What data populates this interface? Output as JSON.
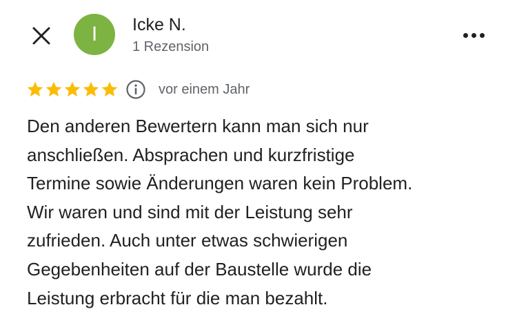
{
  "reviewer": {
    "initial": "I",
    "name": "Icke N.",
    "review_count": "1 Rezension",
    "avatar_color": "#7cb342"
  },
  "review": {
    "rating": 5,
    "max_rating": 5,
    "star_color": "#fbbc04",
    "date": "vor einem Jahr",
    "text_lines": [
      "Den anderen Bewertern kann man sich nur",
      "anschließen. Absprachen und kurzfristige",
      "Termine sowie Änderungen waren kein Problem.",
      "Wir waren und sind mit der Leistung sehr",
      "zufrieden. Auch unter etwas schwierigen",
      "Gegebenheiten auf der Baustelle wurde die",
      "Leistung erbracht für die man bezahlt."
    ]
  },
  "icons": {
    "close": "close-icon",
    "more": "more-vert-icon",
    "info": "info-icon",
    "star": "star-icon"
  }
}
